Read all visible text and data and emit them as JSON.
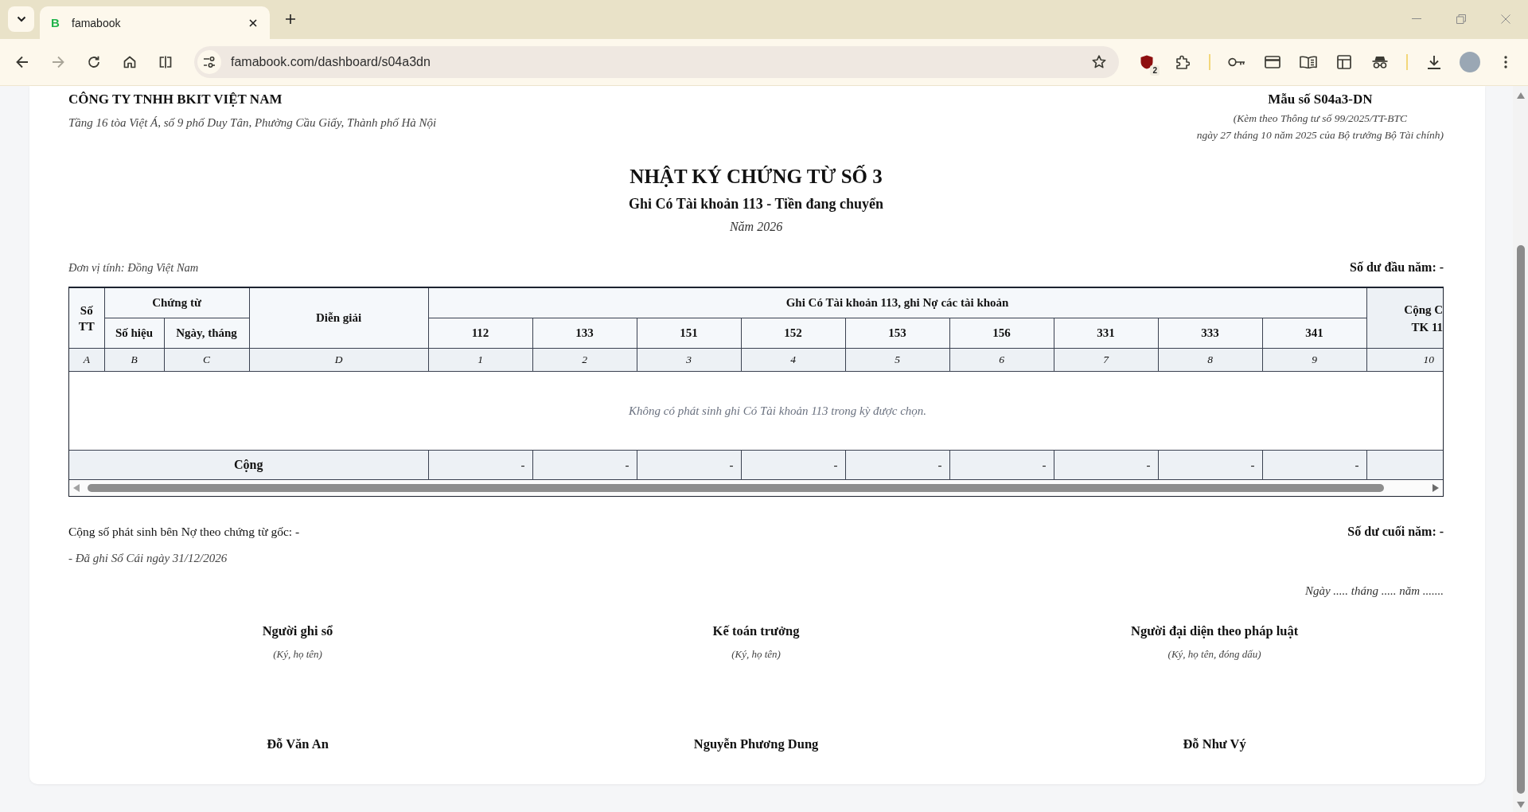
{
  "browser": {
    "tab": {
      "favicon_letter": "B",
      "title": "famabook",
      "selected": true
    },
    "address": "famabook.com/dashboard/s04a3dn",
    "extension_badge": "2"
  },
  "document": {
    "company": {
      "name": "CÔNG TY TNHH BKIT VIỆT NAM",
      "address": "Tầng 16 tòa Việt Á, số 9 phố Duy Tân, Phường Cầu Giấy, Thành phố Hà Nội"
    },
    "form": {
      "code": "Mẫu số S04a3-DN",
      "note_lines": [
        "(Kèm theo Thông tư số 99/2025/TT-BTC",
        "ngày 27 tháng 10 năm 2025 của Bộ trưởng Bộ Tài chính)"
      ]
    },
    "title": "NHẬT KÝ CHỨNG TỪ SỐ 3",
    "subtitle": "Ghi Có Tài khoản 113 - Tiền đang chuyển",
    "year": "Năm 2026",
    "unit": "Đơn vị tính: Đồng Việt Nam",
    "opening_balance": "Số dư đầu năm: -"
  },
  "table": {
    "columns": {
      "no": {
        "label": "Số TT",
        "letter": "A"
      },
      "voucher": {
        "label": "Chứng từ",
        "sub": [
          {
            "label": "Số hiệu",
            "letter": "B"
          },
          {
            "label": "Ngày, tháng",
            "letter": "C"
          }
        ]
      },
      "description": {
        "label": "Diễn giải",
        "letter": "D"
      },
      "accounts": {
        "label": "Ghi Có Tài khoản 113, ghi Nợ các tài khoản",
        "items": [
          {
            "label": "112",
            "letter": "1",
            "total": "-"
          },
          {
            "label": "133",
            "letter": "2",
            "total": "-"
          },
          {
            "label": "151",
            "letter": "3",
            "total": "-"
          },
          {
            "label": "152",
            "letter": "4",
            "total": "-"
          },
          {
            "label": "153",
            "letter": "5",
            "total": "-"
          },
          {
            "label": "156",
            "letter": "6",
            "total": "-"
          },
          {
            "label": "331",
            "letter": "7",
            "total": "-"
          },
          {
            "label": "333",
            "letter": "8",
            "total": "-"
          },
          {
            "label": "341",
            "letter": "9",
            "total": "-"
          }
        ]
      },
      "total": {
        "label_lines": [
          "Cộng C",
          "TK 11"
        ],
        "letter": "10"
      }
    },
    "empty_message": "Không có phát sinh ghi Có Tài khoản 113 trong kỳ được chọn.",
    "total_row": {
      "label": "Cộng"
    }
  },
  "summary": {
    "debit_total": "Cộng số phát sinh bên Nợ theo chứng từ gốc: -",
    "closing_balance": "Số dư cuối năm: -",
    "ledger_note": "- Đã ghi Sổ Cái ngày 31/12/2026",
    "date_line": "Ngày ..... tháng ..... năm ......."
  },
  "signatures": [
    {
      "role": "Người ghi sổ",
      "hint": "(Ký, họ tên)",
      "name": "Đỗ Văn An"
    },
    {
      "role": "Kế toán trưởng",
      "hint": "(Ký, họ tên)",
      "name": "Nguyễn Phương Dung"
    },
    {
      "role": "Người đại diện theo pháp luật",
      "hint": "(Ký, họ tên, đóng dấu)",
      "name": "Đỗ Như Vý"
    }
  ]
}
